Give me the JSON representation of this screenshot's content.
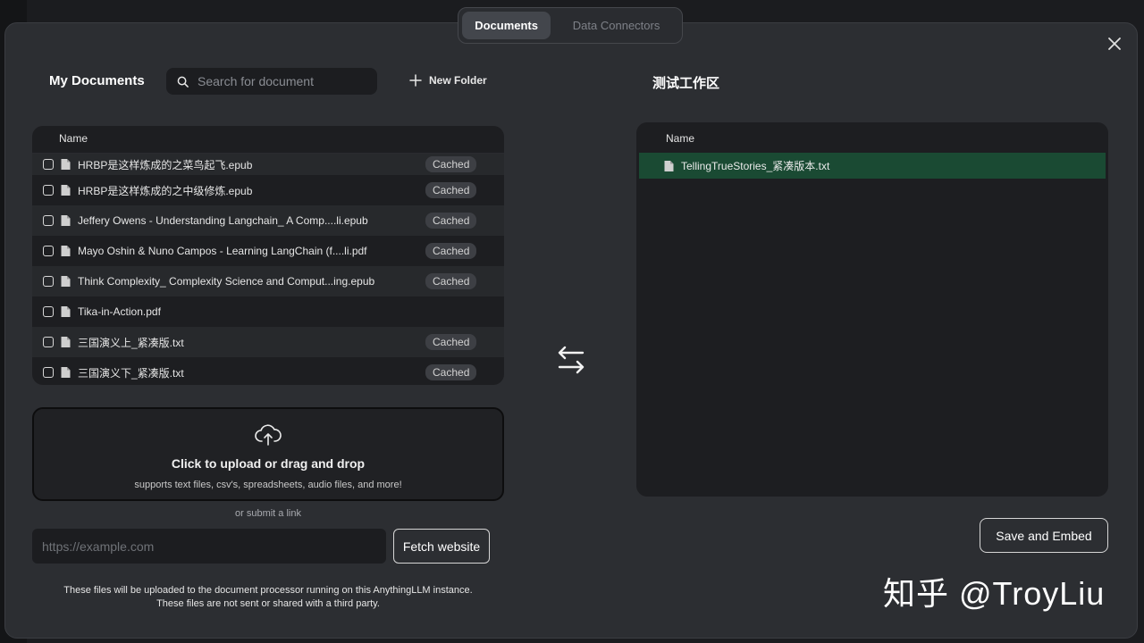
{
  "tabs": {
    "documents": "Documents",
    "data_connectors": "Data Connectors"
  },
  "left": {
    "title": "My Documents",
    "search_placeholder": "Search for document",
    "new_folder": "New Folder",
    "column_name": "Name",
    "files": [
      {
        "name": "HRBP是这样炼成的之菜鸟起飞.epub",
        "status": "Cached"
      },
      {
        "name": "HRBP是这样炼成的之中级修炼.epub",
        "status": "Cached"
      },
      {
        "name": "Jeffery Owens - Understanding Langchain_ A Comp....li.epub",
        "status": "Cached"
      },
      {
        "name": "Mayo Oshin & Nuno Campos - Learning LangChain (f....li.pdf",
        "status": "Cached"
      },
      {
        "name": "Think Complexity_ Complexity Science and Comput...ing.epub",
        "status": "Cached"
      },
      {
        "name": "Tika-in-Action.pdf",
        "status": ""
      },
      {
        "name": "三国演义上_紧凑版.txt",
        "status": "Cached"
      },
      {
        "name": "三国演义下_紧凑版.txt",
        "status": "Cached"
      }
    ],
    "upload_title": "Click to upload or drag and drop",
    "upload_sub": "supports text files, csv's, spreadsheets, audio files, and more!",
    "or_link": "or submit a link",
    "url_placeholder": "https://example.com",
    "fetch": "Fetch website",
    "notice_1": "These files will be uploaded to the document processor running on this AnythingLLM instance.",
    "notice_2": "These files are not sent or shared with a third party."
  },
  "right": {
    "title": "测试工作区",
    "column_name": "Name",
    "files": [
      {
        "name": "TellingTrueStories_紧凑版本.txt"
      }
    ],
    "save_embed": "Save and Embed"
  },
  "watermark": "知乎 @TroyLiu",
  "colors": {
    "modal_bg": "#2c2e32",
    "panel_bg": "#1d1e21",
    "selected_row": "#1a4a33"
  }
}
